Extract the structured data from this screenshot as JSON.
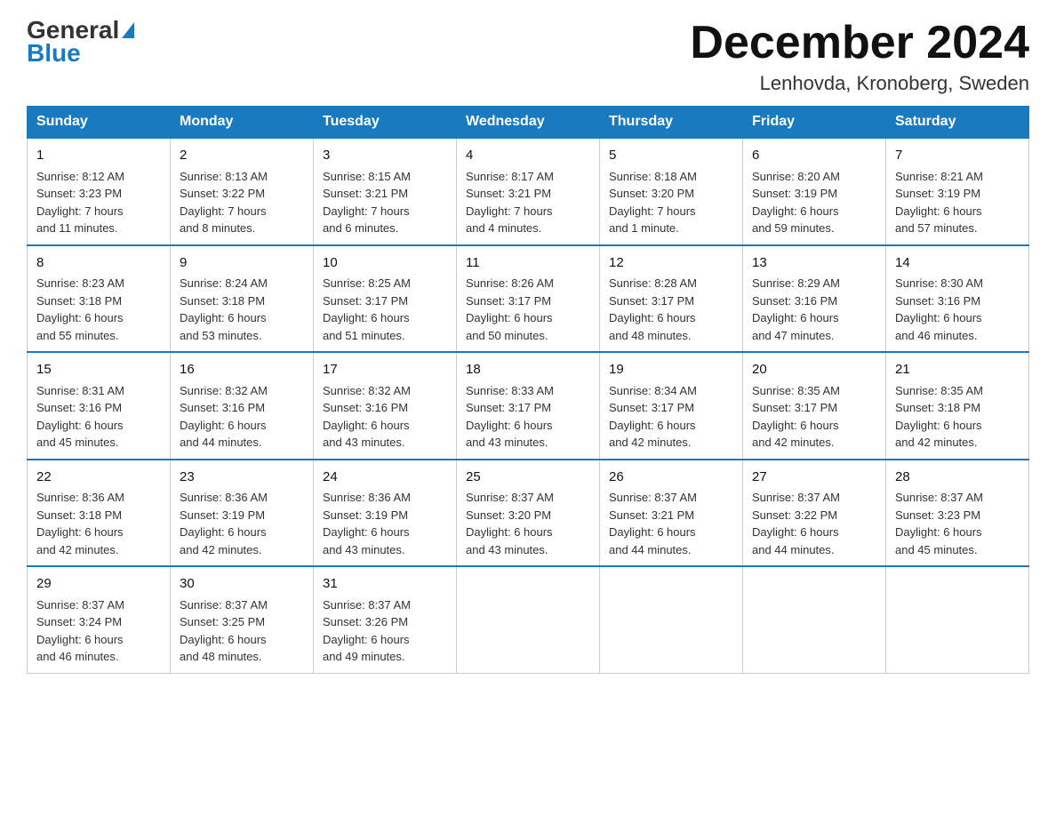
{
  "logo": {
    "general": "General",
    "blue": "Blue"
  },
  "title": "December 2024",
  "subtitle": "Lenhovda, Kronoberg, Sweden",
  "days_of_week": [
    "Sunday",
    "Monday",
    "Tuesday",
    "Wednesday",
    "Thursday",
    "Friday",
    "Saturday"
  ],
  "weeks": [
    [
      {
        "day": "1",
        "sunrise": "8:12 AM",
        "sunset": "3:23 PM",
        "daylight": "7 hours and 11 minutes."
      },
      {
        "day": "2",
        "sunrise": "8:13 AM",
        "sunset": "3:22 PM",
        "daylight": "7 hours and 8 minutes."
      },
      {
        "day": "3",
        "sunrise": "8:15 AM",
        "sunset": "3:21 PM",
        "daylight": "7 hours and 6 minutes."
      },
      {
        "day": "4",
        "sunrise": "8:17 AM",
        "sunset": "3:21 PM",
        "daylight": "7 hours and 4 minutes."
      },
      {
        "day": "5",
        "sunrise": "8:18 AM",
        "sunset": "3:20 PM",
        "daylight": "7 hours and 1 minute."
      },
      {
        "day": "6",
        "sunrise": "8:20 AM",
        "sunset": "3:19 PM",
        "daylight": "6 hours and 59 minutes."
      },
      {
        "day": "7",
        "sunrise": "8:21 AM",
        "sunset": "3:19 PM",
        "daylight": "6 hours and 57 minutes."
      }
    ],
    [
      {
        "day": "8",
        "sunrise": "8:23 AM",
        "sunset": "3:18 PM",
        "daylight": "6 hours and 55 minutes."
      },
      {
        "day": "9",
        "sunrise": "8:24 AM",
        "sunset": "3:18 PM",
        "daylight": "6 hours and 53 minutes."
      },
      {
        "day": "10",
        "sunrise": "8:25 AM",
        "sunset": "3:17 PM",
        "daylight": "6 hours and 51 minutes."
      },
      {
        "day": "11",
        "sunrise": "8:26 AM",
        "sunset": "3:17 PM",
        "daylight": "6 hours and 50 minutes."
      },
      {
        "day": "12",
        "sunrise": "8:28 AM",
        "sunset": "3:17 PM",
        "daylight": "6 hours and 48 minutes."
      },
      {
        "day": "13",
        "sunrise": "8:29 AM",
        "sunset": "3:16 PM",
        "daylight": "6 hours and 47 minutes."
      },
      {
        "day": "14",
        "sunrise": "8:30 AM",
        "sunset": "3:16 PM",
        "daylight": "6 hours and 46 minutes."
      }
    ],
    [
      {
        "day": "15",
        "sunrise": "8:31 AM",
        "sunset": "3:16 PM",
        "daylight": "6 hours and 45 minutes."
      },
      {
        "day": "16",
        "sunrise": "8:32 AM",
        "sunset": "3:16 PM",
        "daylight": "6 hours and 44 minutes."
      },
      {
        "day": "17",
        "sunrise": "8:32 AM",
        "sunset": "3:16 PM",
        "daylight": "6 hours and 43 minutes."
      },
      {
        "day": "18",
        "sunrise": "8:33 AM",
        "sunset": "3:17 PM",
        "daylight": "6 hours and 43 minutes."
      },
      {
        "day": "19",
        "sunrise": "8:34 AM",
        "sunset": "3:17 PM",
        "daylight": "6 hours and 42 minutes."
      },
      {
        "day": "20",
        "sunrise": "8:35 AM",
        "sunset": "3:17 PM",
        "daylight": "6 hours and 42 minutes."
      },
      {
        "day": "21",
        "sunrise": "8:35 AM",
        "sunset": "3:18 PM",
        "daylight": "6 hours and 42 minutes."
      }
    ],
    [
      {
        "day": "22",
        "sunrise": "8:36 AM",
        "sunset": "3:18 PM",
        "daylight": "6 hours and 42 minutes."
      },
      {
        "day": "23",
        "sunrise": "8:36 AM",
        "sunset": "3:19 PM",
        "daylight": "6 hours and 42 minutes."
      },
      {
        "day": "24",
        "sunrise": "8:36 AM",
        "sunset": "3:19 PM",
        "daylight": "6 hours and 43 minutes."
      },
      {
        "day": "25",
        "sunrise": "8:37 AM",
        "sunset": "3:20 PM",
        "daylight": "6 hours and 43 minutes."
      },
      {
        "day": "26",
        "sunrise": "8:37 AM",
        "sunset": "3:21 PM",
        "daylight": "6 hours and 44 minutes."
      },
      {
        "day": "27",
        "sunrise": "8:37 AM",
        "sunset": "3:22 PM",
        "daylight": "6 hours and 44 minutes."
      },
      {
        "day": "28",
        "sunrise": "8:37 AM",
        "sunset": "3:23 PM",
        "daylight": "6 hours and 45 minutes."
      }
    ],
    [
      {
        "day": "29",
        "sunrise": "8:37 AM",
        "sunset": "3:24 PM",
        "daylight": "6 hours and 46 minutes."
      },
      {
        "day": "30",
        "sunrise": "8:37 AM",
        "sunset": "3:25 PM",
        "daylight": "6 hours and 48 minutes."
      },
      {
        "day": "31",
        "sunrise": "8:37 AM",
        "sunset": "3:26 PM",
        "daylight": "6 hours and 49 minutes."
      },
      null,
      null,
      null,
      null
    ]
  ],
  "labels": {
    "sunrise": "Sunrise:",
    "sunset": "Sunset:",
    "daylight": "Daylight:"
  }
}
